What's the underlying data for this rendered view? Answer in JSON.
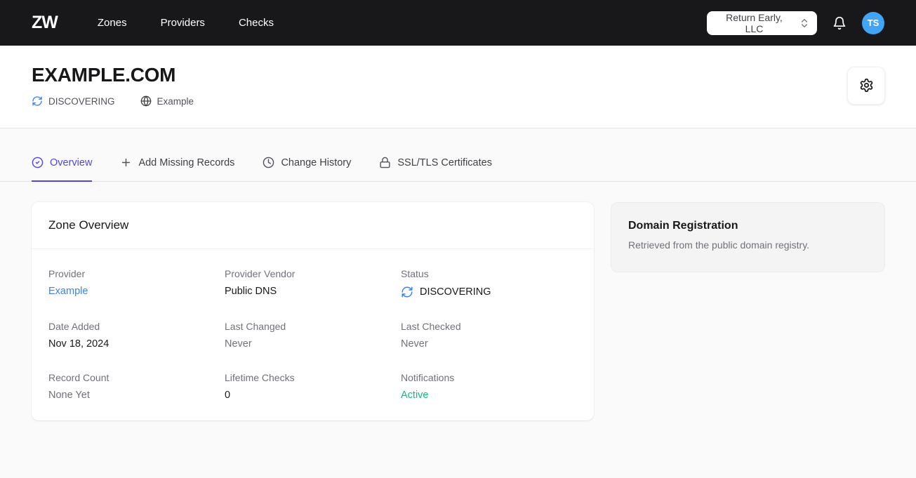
{
  "navbar": {
    "logo": "ZW",
    "items": [
      {
        "label": "Zones"
      },
      {
        "label": "Providers"
      },
      {
        "label": "Checks"
      }
    ],
    "org_selector": "Return Early, LLC",
    "bell_icon": "bell-icon",
    "avatar_initials": "TS"
  },
  "header": {
    "title": "EXAMPLE.COM",
    "status": "DISCOVERING",
    "status_icon": "sync-icon",
    "provider": "Example",
    "provider_icon": "globe-icon",
    "settings_icon": "gear-icon"
  },
  "tabs": [
    {
      "label": "Overview",
      "icon": "check-circle-icon",
      "active": true
    },
    {
      "label": "Add Missing Records",
      "icon": "plus-icon",
      "active": false
    },
    {
      "label": "Change History",
      "icon": "clock-icon",
      "active": false
    },
    {
      "label": "SSL/TLS Certificates",
      "icon": "lock-icon",
      "active": false
    }
  ],
  "zone_overview": {
    "title": "Zone Overview",
    "fields": [
      {
        "label": "Provider",
        "value": "Example",
        "type": "link"
      },
      {
        "label": "Provider Vendor",
        "value": "Public DNS",
        "type": "text"
      },
      {
        "label": "Status",
        "value": "DISCOVERING",
        "type": "status",
        "icon": "sync-icon"
      },
      {
        "label": "Date Added",
        "value": "Nov 18, 2024",
        "type": "text"
      },
      {
        "label": "Last Changed",
        "value": "Never",
        "type": "muted"
      },
      {
        "label": "Last Checked",
        "value": "Never",
        "type": "muted"
      },
      {
        "label": "Record Count",
        "value": "None Yet",
        "type": "muted"
      },
      {
        "label": "Lifetime Checks",
        "value": "0",
        "type": "text"
      },
      {
        "label": "Notifications",
        "value": "Active",
        "type": "success"
      }
    ]
  },
  "domain_registration": {
    "title": "Domain Registration",
    "description": "Retrieved from the public domain registry."
  },
  "colors": {
    "navbar_bg": "#18181b",
    "accent_indigo": "#4f46e5",
    "link_blue": "#3b82f6",
    "status_green": "#10b981",
    "spinner_blue": "#3b82f6",
    "avatar_bg": "#42a4f5",
    "page_bg": "#fafafa",
    "side_card_bg": "#f4f4f5"
  }
}
